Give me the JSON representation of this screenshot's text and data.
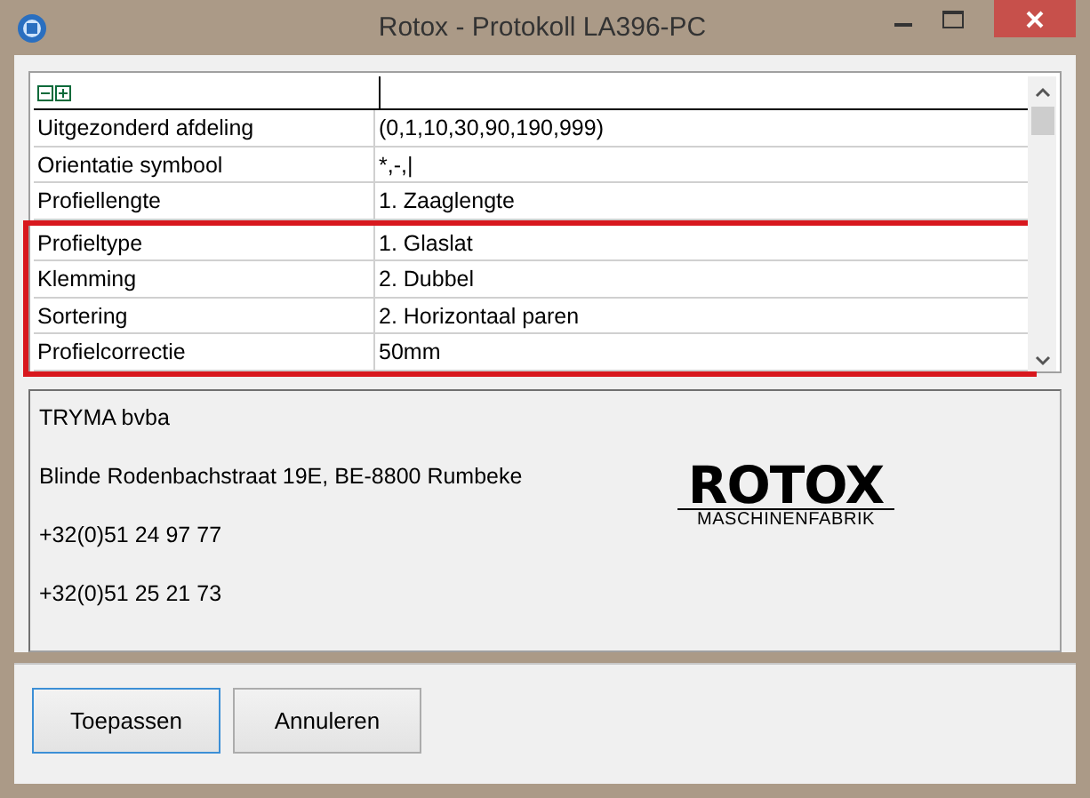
{
  "window": {
    "title": "Rotox - Protokoll LA396-PC"
  },
  "grid": {
    "rows": [
      {
        "name": "Uitgezonderd afdeling",
        "value": "(0,1,10,30,90,190,999)",
        "highlighted": false
      },
      {
        "name": "Orientatie symbool",
        "value": "*,-,|",
        "highlighted": false
      },
      {
        "name": "Profiellengte",
        "value": "1. Zaaglengte",
        "highlighted": false
      },
      {
        "name": "Profieltype",
        "value": "1. Glaslat",
        "highlighted": true
      },
      {
        "name": "Klemming",
        "value": "2. Dubbel",
        "highlighted": true
      },
      {
        "name": "Sortering",
        "value": "2. Horizontaal paren",
        "highlighted": true
      },
      {
        "name": "Profielcorrectie",
        "value": "50mm",
        "highlighted": true
      }
    ]
  },
  "info": {
    "lines": [
      "TRYMA bvba",
      "Blinde Rodenbachstraat 19E, BE-8800 Rumbeke",
      "+32(0)51 24 97 77",
      "+32(0)51 25 21 73"
    ],
    "logo": {
      "name": "ROTOX",
      "subtitle": "MASCHINENFABRIK"
    }
  },
  "buttons": [
    {
      "label": "Toepassen",
      "default": true
    },
    {
      "label": "Annuleren",
      "default": false
    }
  ]
}
